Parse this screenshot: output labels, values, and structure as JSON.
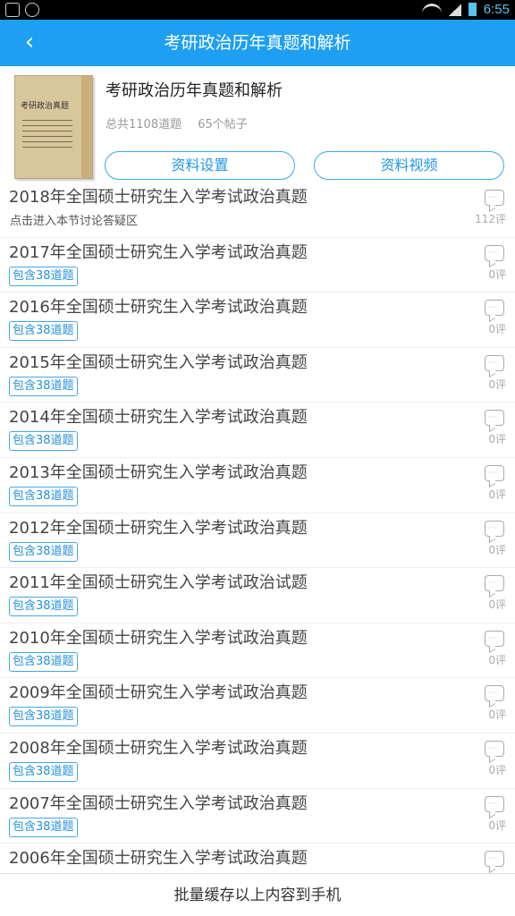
{
  "status_bar": {
    "time": "6:55"
  },
  "header": {
    "back_icon": "chevron-left-icon",
    "back_glyph": "‹",
    "title": "考研政治历年真题和解析"
  },
  "book": {
    "cover_title": "考研政治真题",
    "name": "考研政治历年真题和解析",
    "total_questions": "总共1108道题",
    "posts": "65个帖子",
    "settings_label": "资料设置",
    "video_label": "资料视频"
  },
  "items": [
    {
      "title": "2018年全国硕士研究生入学考试政治真题",
      "sub": "点击进入本节讨论答疑区",
      "comments": "112评"
    },
    {
      "title": "2017年全国硕士研究生入学考试政治真题",
      "badge": "包含38道题",
      "comments": "0评"
    },
    {
      "title": "2016年全国硕士研究生入学考试政治真题",
      "badge": "包含38道题",
      "comments": "0评"
    },
    {
      "title": "2015年全国硕士研究生入学考试政治真题",
      "badge": "包含38道题",
      "comments": "0评"
    },
    {
      "title": "2014年全国硕士研究生入学考试政治真题",
      "badge": "包含38道题",
      "comments": "0评"
    },
    {
      "title": "2013年全国硕士研究生入学考试政治真题",
      "badge": "包含38道题",
      "comments": "0评"
    },
    {
      "title": "2012年全国硕士研究生入学考试政治真题",
      "badge": "包含38道题",
      "comments": "0评"
    },
    {
      "title": "2011年全国硕士研究生入学考试政治试题",
      "badge": "包含38道题",
      "comments": "0评"
    },
    {
      "title": "2010年全国硕士研究生入学考试政治真题",
      "badge": "包含38道题",
      "comments": "0评"
    },
    {
      "title": "2009年全国硕士研究生入学考试政治真题",
      "badge": "包含38道题",
      "comments": "0评"
    },
    {
      "title": "2008年全国硕士研究生入学考试政治真题",
      "badge": "包含38道题",
      "comments": "0评"
    },
    {
      "title": "2007年全国硕士研究生入学考试政治真题",
      "badge": "包含38道题",
      "comments": "0评"
    },
    {
      "title": "2006年全国硕士研究生入学考试政治真题",
      "badge": "",
      "comments": ""
    }
  ],
  "footer": {
    "label": "批量缓存以上内容到手机"
  },
  "colors": {
    "accent": "#1e9ff2",
    "badge": "#2490dc"
  }
}
